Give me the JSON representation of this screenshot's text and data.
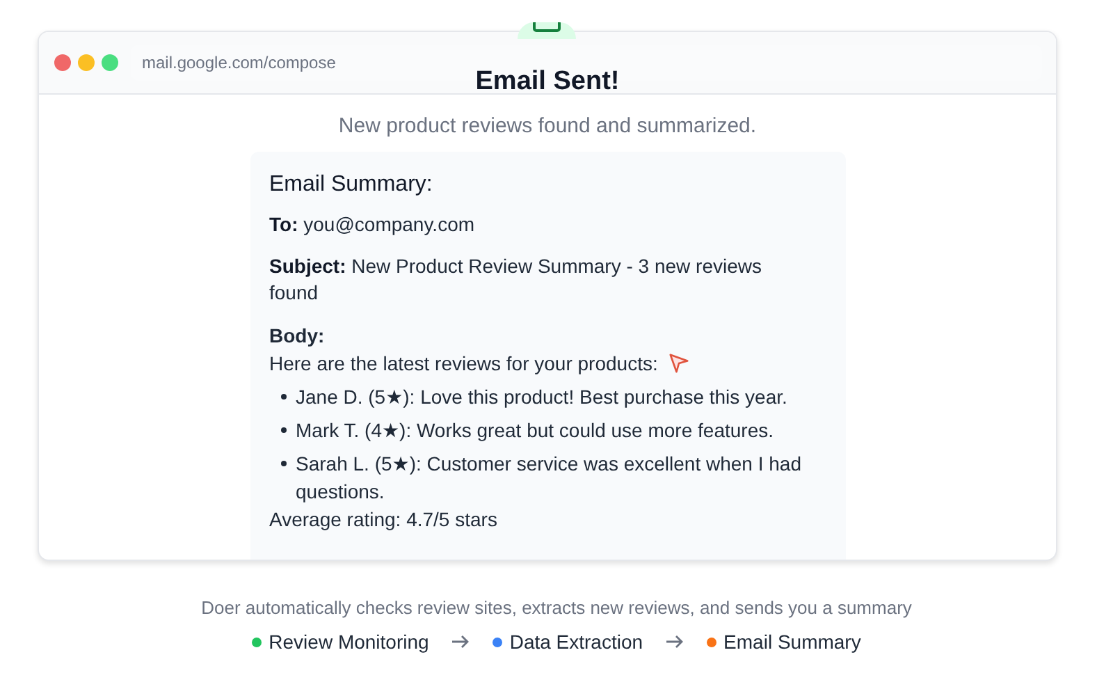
{
  "browser": {
    "url": "mail.google.com/compose"
  },
  "heading": "Email Sent!",
  "subtitle": "New product reviews found and summarized.",
  "summary": {
    "title": "Email Summary:",
    "fields": [
      "**To:** you@company.com",
      "**Subject:** New Product Review Summary - 3 new reviews found"
    ],
    "body_label": "Body:",
    "intro": "Here are the latest reviews for your products:",
    "reviews": [
      "Jane D. (5★): Love this product! Best purchase this year.",
      "Mark T. (4★): Works great but could use more features.",
      "Sarah L. (5★): Customer service was excellent when I had questions."
    ],
    "closing": "Average rating: 4.7/5 stars"
  },
  "footer": {
    "caption": "Doer automatically checks review sites, extracts new reviews, and sends you a summary",
    "steps": [
      {
        "label": "Review Monitoring",
        "color": "#22c55e"
      },
      {
        "label": "Data Extraction",
        "color": "#3b82f6"
      },
      {
        "label": "Email Summary",
        "color": "#f97316"
      }
    ]
  }
}
